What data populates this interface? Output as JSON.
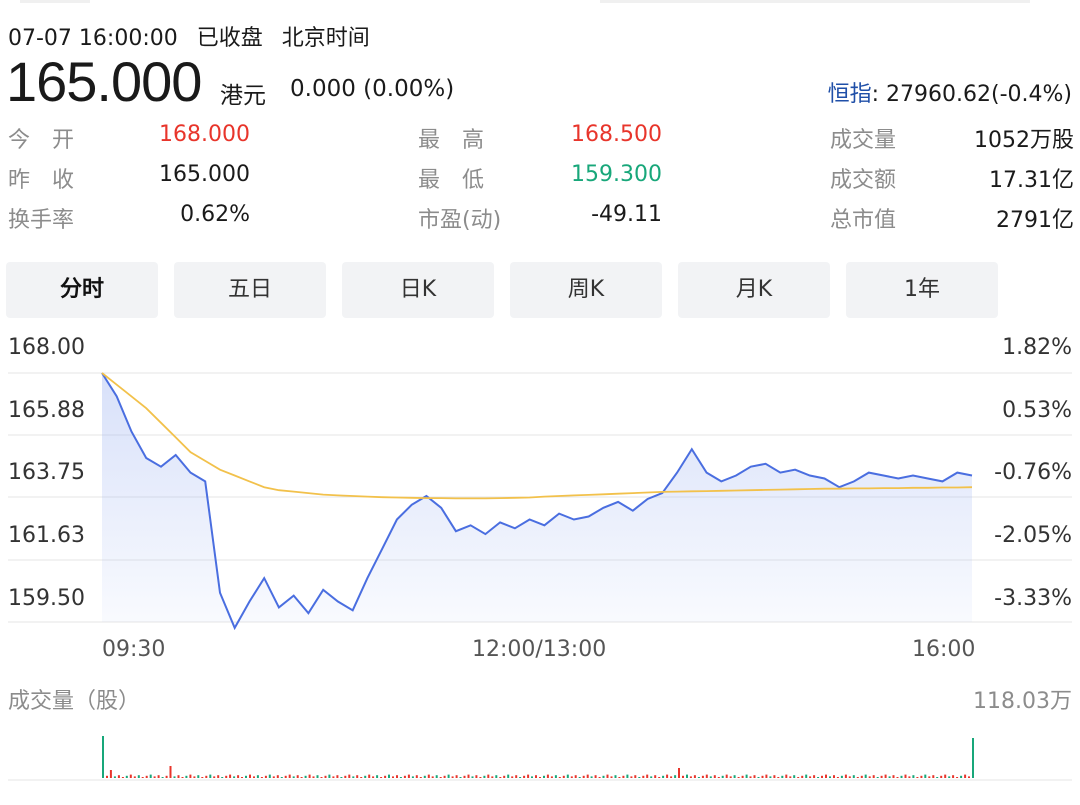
{
  "header": {
    "datetime": "07-07 16:00:00",
    "status": "已收盘",
    "timezone": "北京时间"
  },
  "quote": {
    "price": "165.000",
    "currency": "港元",
    "change": "0.000 (0.00%)",
    "index_name": "恒指",
    "index_value": ": 27960.62(-0.4%)"
  },
  "stats": [
    [
      {
        "label": "今　开",
        "value": "168.000",
        "color": "#e8352b"
      },
      {
        "label": "最　高",
        "value": "168.500",
        "color": "#e8352b"
      },
      {
        "label": "成交量",
        "value": "1052万股",
        "color": "#1a1a1a"
      }
    ],
    [
      {
        "label": "昨　收",
        "value": "165.000",
        "color": "#1a1a1a"
      },
      {
        "label": "最　低",
        "value": "159.300",
        "color": "#18a77a"
      },
      {
        "label": "成交额",
        "value": "17.31亿",
        "color": "#1a1a1a"
      }
    ],
    [
      {
        "label": "换手率",
        "value": "0.62%",
        "color": "#1a1a1a"
      },
      {
        "label": "市盈(动)",
        "value": "-49.11",
        "color": "#1a1a1a"
      },
      {
        "label": "总市值",
        "value": "2791亿",
        "color": "#1a1a1a"
      }
    ]
  ],
  "tabs": [
    "分时",
    "五日",
    "日K",
    "周K",
    "月K",
    "1年"
  ],
  "active_tab": "分时",
  "chart": {
    "y_labels_left": [
      "168.00",
      "165.88",
      "163.75",
      "161.63",
      "159.50"
    ],
    "y_labels_right": [
      "1.82%",
      "0.53%",
      "-0.76%",
      "-2.05%",
      "-3.33%"
    ],
    "x_labels": [
      "09:30",
      "12:00/13:00",
      "16:00"
    ],
    "volume_title": "成交量（股）",
    "volume_max": "118.03万",
    "footer": " "
  },
  "chart_data": {
    "type": "line",
    "ylim": [
      159.5,
      168.0
    ],
    "series": [
      {
        "values": [
          168.0,
          167.2,
          166.0,
          165.1,
          164.8,
          165.2,
          164.6,
          164.3,
          160.5,
          159.3,
          160.2,
          161.0,
          160.0,
          160.4,
          159.8,
          160.6,
          160.2,
          159.9,
          161.0,
          162.0,
          163.0,
          163.5,
          163.8,
          163.4,
          162.6,
          162.8,
          162.5,
          162.9,
          162.7,
          163.0,
          162.8,
          163.2,
          163.0,
          163.1,
          163.4,
          163.6,
          163.3,
          163.7,
          163.9,
          164.6,
          165.4,
          164.6,
          164.3,
          164.5,
          164.8,
          164.9,
          164.6,
          164.7,
          164.5,
          164.4,
          164.1,
          164.3,
          164.6,
          164.5,
          164.4,
          164.5,
          164.4,
          164.3,
          164.6,
          164.5
        ],
        "color": "#4a6ee0"
      },
      {
        "values": [
          168.0,
          167.6,
          167.2,
          166.8,
          166.3,
          165.8,
          165.3,
          165.0,
          164.7,
          164.5,
          164.3,
          164.1,
          164.0,
          163.95,
          163.9,
          163.85,
          163.82,
          163.8,
          163.78,
          163.76,
          163.75,
          163.74,
          163.73,
          163.73,
          163.72,
          163.72,
          163.72,
          163.73,
          163.74,
          163.75,
          163.78,
          163.8,
          163.82,
          163.84,
          163.86,
          163.88,
          163.9,
          163.92,
          163.94,
          163.95,
          163.96,
          163.97,
          163.98,
          163.99,
          164.0,
          164.01,
          164.02,
          164.03,
          164.04,
          164.05,
          164.05,
          164.06,
          164.06,
          164.07,
          164.07,
          164.08,
          164.08,
          164.09,
          164.09,
          164.1
        ],
        "color": "#f2c14b"
      }
    ]
  }
}
